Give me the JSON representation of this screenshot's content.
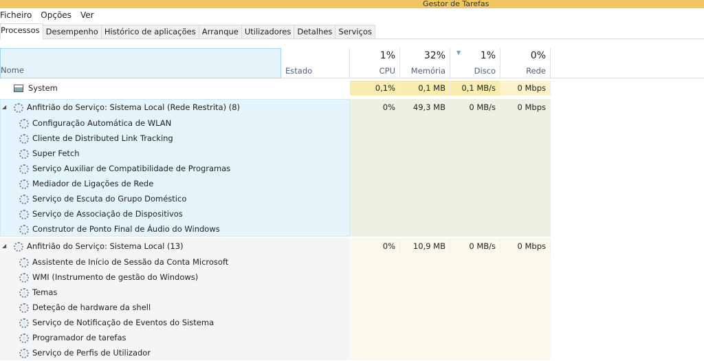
{
  "window": {
    "title": "Gestor de Tarefas"
  },
  "menu": [
    "Ficheiro",
    "Opções",
    "Ver"
  ],
  "tabs": [
    "Processos",
    "Desempenho",
    "Histórico de aplicações",
    "Arranque",
    "Utilizadores",
    "Detalhes",
    "Serviços"
  ],
  "columns": {
    "name": "Nome",
    "state": "Estado",
    "cpu": {
      "pct": "1%",
      "label": "CPU"
    },
    "memory": {
      "pct": "32%",
      "label": "Memória"
    },
    "disk": {
      "pct": "1%",
      "label": "Disco"
    },
    "network": {
      "pct": "0%",
      "label": "Rede"
    }
  },
  "system": {
    "name": "System",
    "cpu": "0,1%",
    "mem": "0,1 MB",
    "disk": "0,1 MB/s",
    "net": "0 Mbps"
  },
  "groups": [
    {
      "name": "Anfitrião do Serviço: Sistema Local (Rede Restrita) (8)",
      "cpu": "0%",
      "mem": "49,3 MB",
      "disk": "0 MB/s",
      "net": "0 Mbps",
      "children": [
        "Configuração Automática de WLAN",
        "Cliente de Distributed Link Tracking",
        "Super Fetch",
        "Serviço Auxiliar de Compatibilidade de Programas",
        "Mediador de Ligações de Rede",
        "Serviço de Escuta do Grupo Doméstico",
        "Serviço de Associação de Dispositivos",
        "Construtor de Ponto Final de Áudio do Windows"
      ]
    },
    {
      "name": "Anfitrião do Serviço: Sistema Local (13)",
      "cpu": "0%",
      "mem": "10,9 MB",
      "disk": "0 MB/s",
      "net": "0 Mbps",
      "children": [
        "Assistente de Início de Sessão da Conta Microsoft",
        "WMI (Instrumento de gestão do Windows)",
        "Temas",
        "Deteção de hardware da shell",
        "Serviço de Notificação de Eventos do Sistema",
        "Programador de tarefas",
        "Serviço de Perfis de Utilizador"
      ]
    }
  ]
}
